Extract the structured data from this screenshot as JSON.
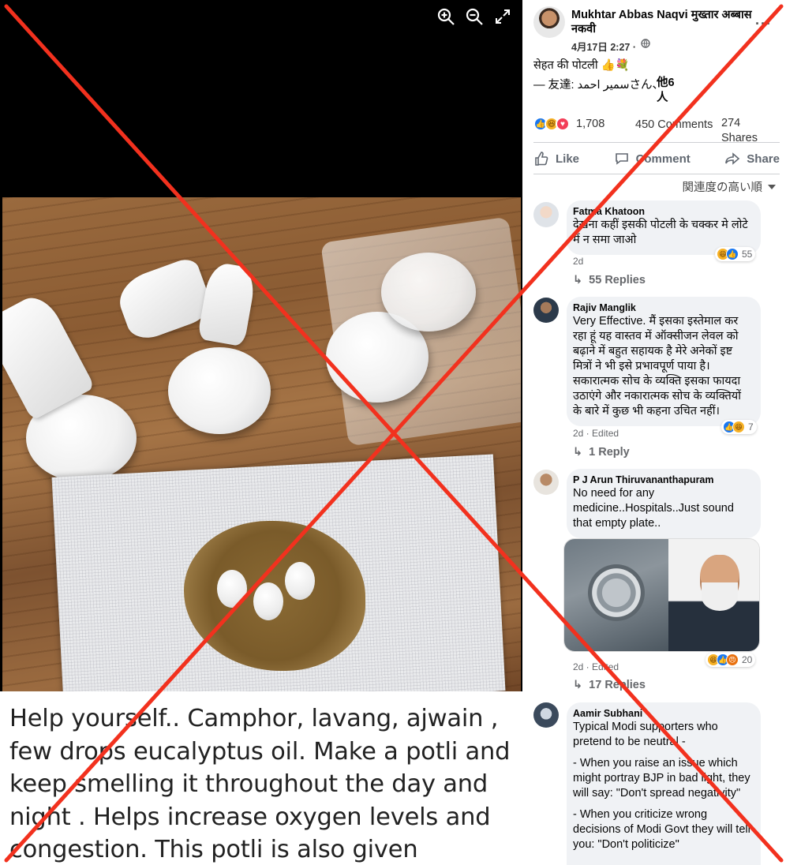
{
  "viewer": {
    "tools": {
      "zoom_in": "zoom-in-icon",
      "zoom_out": "zoom-out-icon",
      "fullscreen": "expand-icon"
    },
    "caption": "Help yourself.. Camphor, lavang, ajwain , few drops eucalyptus oil. Make a potli and keep smelling it throughout the day and night . Helps increase oxygen levels and congestion. This potli is also given"
  },
  "post": {
    "author": "Mukhtar Abbas Naqvi मुख्तार अब्बास नकवी",
    "date": "4月17日 2:27 ·",
    "privacy_icon": "globe-icon",
    "more_label": "···",
    "text": "सेहत की पोटली 👍💐",
    "tagged": "— 友達: سمیر احمدさん、",
    "tagged_others": "他6人",
    "reaction_count": "1,708",
    "comment_count": "450 Comments",
    "share_count": "274 Shares",
    "actions": {
      "like": "Like",
      "comment": "Comment",
      "share": "Share"
    },
    "sort_label": "関連度の高い順"
  },
  "comments": [
    {
      "name": "Fatma Khatoon",
      "lines": [
        "देखना कहीं इसकी पोटली के चक्कर मे लोटे में न समा जाओ"
      ],
      "meta": "2d",
      "reaction_total": "55",
      "replies": "55 Replies"
    },
    {
      "name": "Rajiv Manglik",
      "lines": [
        "Very Effective. मैं इसका इस्तेमाल कर रहा हूं यह वास्तव में ऑक्सीजन लेवल को बढ़ाने में बहुत सहायक है मेरे अनेकों इष्ट मित्रों ने भी इसे प्रभावपूर्ण पाया है। सकारात्मक सोच के व्यक्ति इसका फायदा उठाएंगे और नकारात्मक सोच के व्यक्तियों के बारे में कुछ भी कहना उचित नहीं।"
      ],
      "meta": "2d · Edited",
      "reaction_total": "7",
      "replies": "1 Reply"
    },
    {
      "name": "P J Arun Thiruvananthapuram",
      "lines": [
        "No need for any medicine..Hospitals..Just sound that empty plate.."
      ],
      "meta": "2d · Edited",
      "reaction_total": "20",
      "replies": "17 Replies"
    },
    {
      "name": "Aamir Subhani",
      "lines": [
        "Typical Modi supporters who pretend to be neutral -",
        "- When you raise an issue which might portray BJP in bad light, they will say: \"Don't spread negativity\"",
        "- When you criticize wrong decisions of Modi Govt they will tell you: \"Don't politicize\""
      ]
    }
  ],
  "colors": {
    "accent": "#1877f2",
    "cross": "#f2311e",
    "muted": "#65676b"
  }
}
